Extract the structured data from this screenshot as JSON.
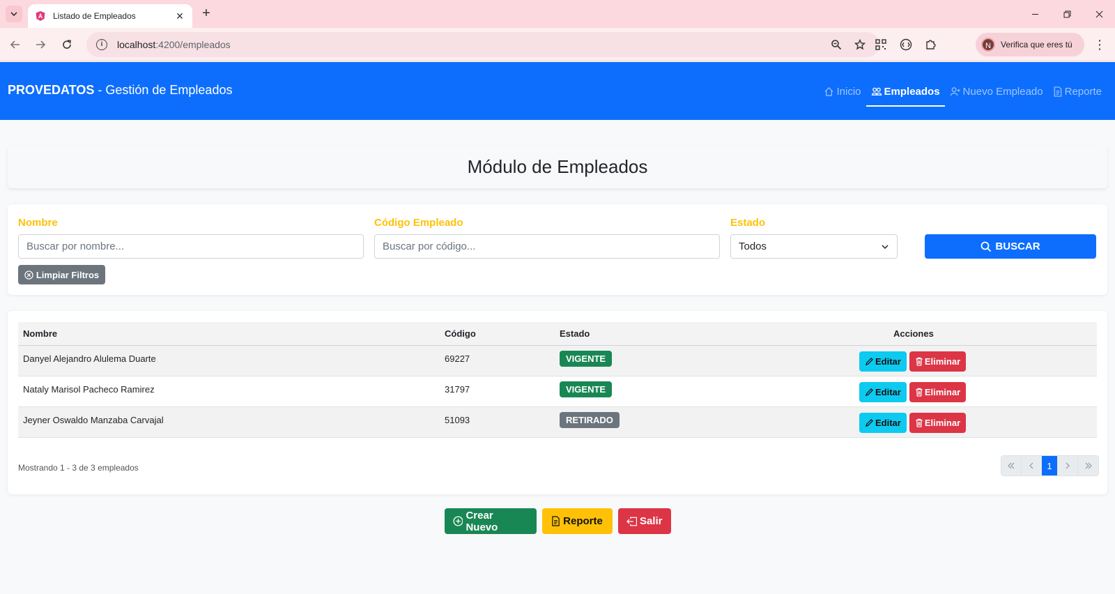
{
  "browser": {
    "tab_title": "Listado de Empleados",
    "url_host": "localhost",
    "url_rest": ":4200/empleados",
    "profile_initial": "N",
    "profile_text": "Verifica que eres tú"
  },
  "navbar": {
    "brand_bold": "PROVEDATOS",
    "brand_rest": " - Gestión de Empleados",
    "links": [
      {
        "label": "Inicio",
        "icon": "house-icon",
        "active": false
      },
      {
        "label": "Empleados",
        "icon": "people-icon",
        "active": true
      },
      {
        "label": "Nuevo Empleado",
        "icon": "person-add-icon",
        "active": false
      },
      {
        "label": "Reporte",
        "icon": "file-text-icon",
        "active": false
      }
    ]
  },
  "page": {
    "title": "Módulo de Empleados"
  },
  "filters": {
    "name_label": "Nombre",
    "name_placeholder": "Buscar por nombre...",
    "code_label": "Código Empleado",
    "code_placeholder": "Buscar por código...",
    "status_label": "Estado",
    "status_value": "Todos",
    "search_button": "BUSCAR",
    "clear_button": "Limpiar Filtros"
  },
  "table": {
    "columns": [
      "Nombre",
      "Código",
      "Estado",
      "Acciones"
    ],
    "rows": [
      {
        "name": "Danyel Alejandro Alulema Duarte",
        "code": "69227",
        "status": "VIGENTE",
        "status_color": "#198754"
      },
      {
        "name": "Nataly Marisol Pacheco Ramirez",
        "code": "31797",
        "status": "VIGENTE",
        "status_color": "#198754"
      },
      {
        "name": "Jeyner Oswaldo Manzaba Carvajal",
        "code": "51093",
        "status": "RETIRADO",
        "status_color": "#6c757d"
      }
    ],
    "edit_label": "Editar",
    "delete_label": "Eliminar",
    "showing_text": "Mostrando 1 - 3 de 3 empleados",
    "current_page": "1"
  },
  "actions": {
    "create_label": "Crear Nuevo",
    "report_label": "Reporte",
    "exit_label": "Salir"
  },
  "colors": {
    "primary": "#0d6efd",
    "success": "#198754",
    "warning": "#ffc107",
    "danger": "#dc3545",
    "info": "#0dcaf0",
    "secondary": "#6c757d"
  }
}
